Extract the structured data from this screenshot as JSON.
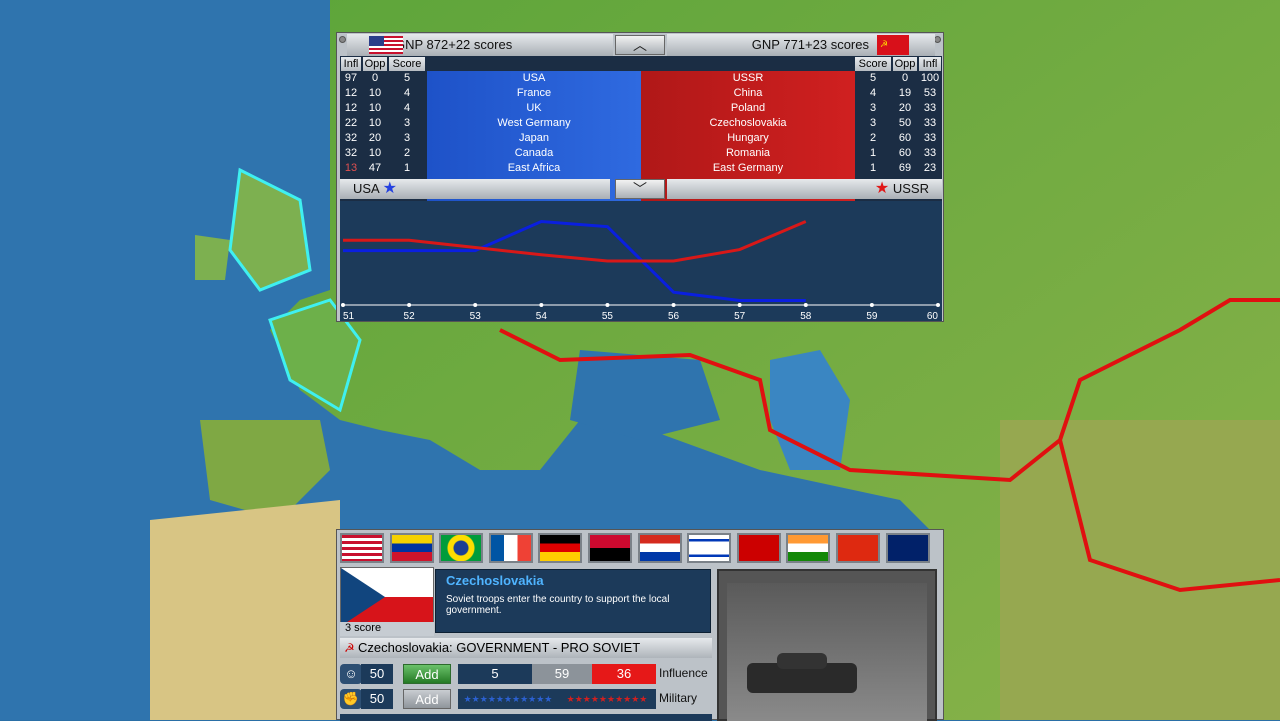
{
  "header": {
    "left_gnp": "GNP 872+22 scores",
    "right_gnp": "GNP 771+23 scores"
  },
  "columns": {
    "infl": "Infl",
    "opp": "Opp",
    "score": "Score"
  },
  "west": [
    {
      "infl": "97",
      "opp": "0",
      "score": "5",
      "name": "USA"
    },
    {
      "infl": "12",
      "opp": "10",
      "score": "4",
      "name": "France"
    },
    {
      "infl": "12",
      "opp": "10",
      "score": "4",
      "name": "UK"
    },
    {
      "infl": "22",
      "opp": "10",
      "score": "3",
      "name": "West Germany"
    },
    {
      "infl": "32",
      "opp": "20",
      "score": "3",
      "name": "Japan"
    },
    {
      "infl": "32",
      "opp": "10",
      "score": "2",
      "name": "Canada"
    },
    {
      "infl": "13",
      "opp": "47",
      "score": "1",
      "name": "East Africa"
    }
  ],
  "east": [
    {
      "name": "USSR",
      "score": "5",
      "opp": "0",
      "infl": "100"
    },
    {
      "name": "China",
      "score": "4",
      "opp": "19",
      "infl": "53"
    },
    {
      "name": "Poland",
      "score": "3",
      "opp": "20",
      "infl": "33"
    },
    {
      "name": "Czechoslovakia",
      "score": "3",
      "opp": "50",
      "infl": "33"
    },
    {
      "name": "Hungary",
      "score": "2",
      "opp": "60",
      "infl": "33"
    },
    {
      "name": "Romania",
      "score": "1",
      "opp": "60",
      "infl": "33"
    },
    {
      "name": "East Germany",
      "score": "1",
      "opp": "69",
      "infl": "23"
    }
  ],
  "legend": {
    "left": "USA",
    "right": "USSR"
  },
  "chart_data": {
    "type": "line",
    "x": [
      51,
      52,
      53,
      54,
      55,
      56,
      57,
      58
    ],
    "xticks": [
      "51",
      "52",
      "53",
      "54",
      "55",
      "56",
      "57",
      "58",
      "59",
      "60"
    ],
    "xlim": [
      51,
      60
    ],
    "series": [
      {
        "name": "USA",
        "color": "#0a1fe0",
        "values": [
          60,
          60,
          60,
          88,
          83,
          20,
          12,
          12
        ]
      },
      {
        "name": "USSR",
        "color": "#d81818",
        "values": [
          70,
          70,
          63,
          56,
          50,
          50,
          61,
          88
        ]
      }
    ]
  },
  "country": {
    "name": "Czechoslovakia",
    "description": "Soviet troops enter the country to support the local government.",
    "score": "3 score",
    "government": "Czechoslovakia: GOVERNMENT - PRO SOVIET"
  },
  "influence": {
    "west": "5",
    "neutral": "59",
    "east": "36",
    "label": "Influence"
  },
  "military": {
    "label": "Military"
  },
  "resources": [
    {
      "value": "50"
    },
    {
      "value": "50"
    }
  ],
  "add_label": "Add",
  "flags": [
    "USA",
    "Venezuela",
    "Brazil",
    "France",
    "East Germany",
    "Angola",
    "Paraguay",
    "Israel",
    "USSR",
    "India",
    "China",
    "Australia"
  ]
}
